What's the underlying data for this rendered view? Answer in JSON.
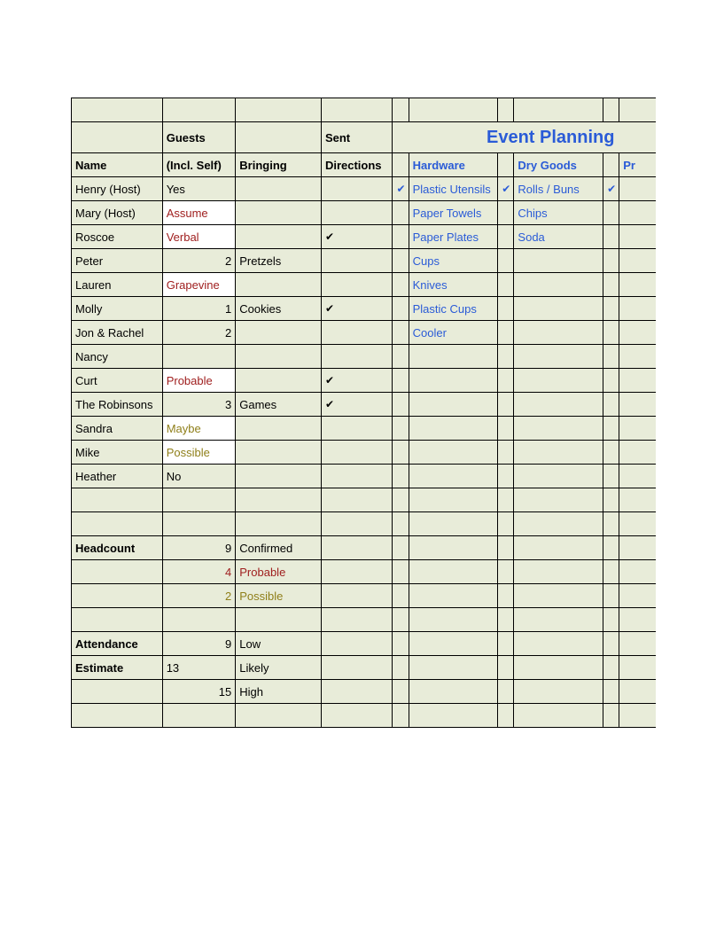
{
  "title": "Event Planning",
  "headers": {
    "guests": "Guests",
    "sent": "Sent",
    "name": "Name",
    "incl": "(Incl. Self)",
    "bringing": "Bringing",
    "directions": "Directions",
    "hardware": "Hardware",
    "drygoods": "Dry Goods",
    "pr": "Pr"
  },
  "rows": [
    {
      "name": "Henry (Host)",
      "guests": "Yes",
      "gcls": "",
      "bring": "",
      "sent": "",
      "hw_chk": "✔",
      "hw": "Plastic Utensils",
      "dg_chk": "✔",
      "dg": "Rolls / Buns",
      "pr_chk": "✔"
    },
    {
      "name": "Mary (Host)",
      "guests": "Assume",
      "gcls": "red white-bg",
      "bring": "",
      "sent": "",
      "hw_chk": "",
      "hw": "Paper Towels",
      "dg_chk": "",
      "dg": "Chips",
      "pr_chk": ""
    },
    {
      "name": "Roscoe",
      "guests": "Verbal",
      "gcls": "red white-bg",
      "bring": "",
      "sent": "✔",
      "hw_chk": "",
      "hw": "Paper Plates",
      "dg_chk": "",
      "dg": "Soda",
      "pr_chk": ""
    },
    {
      "name": "Peter",
      "guests": "2",
      "gcls": "right",
      "bring": "Pretzels",
      "sent": "",
      "hw_chk": "",
      "hw": "Cups",
      "dg_chk": "",
      "dg": "",
      "pr_chk": ""
    },
    {
      "name": "Lauren",
      "guests": "Grapevine",
      "gcls": "red white-bg",
      "bring": "",
      "sent": "",
      "hw_chk": "",
      "hw": "Knives",
      "dg_chk": "",
      "dg": "",
      "pr_chk": ""
    },
    {
      "name": "Molly",
      "guests": "1",
      "gcls": "right",
      "bring": "Cookies",
      "sent": "✔",
      "hw_chk": "",
      "hw": "Plastic Cups",
      "dg_chk": "",
      "dg": "",
      "pr_chk": ""
    },
    {
      "name": "Jon & Rachel",
      "guests": "2",
      "gcls": "right",
      "bring": "",
      "sent": "",
      "hw_chk": "",
      "hw": "Cooler",
      "dg_chk": "",
      "dg": "",
      "pr_chk": ""
    },
    {
      "name": "Nancy",
      "guests": "",
      "gcls": "",
      "bring": "",
      "sent": "",
      "hw_chk": "",
      "hw": "",
      "dg_chk": "",
      "dg": "",
      "pr_chk": ""
    },
    {
      "name": "Curt",
      "guests": "Probable",
      "gcls": "red white-bg",
      "bring": "",
      "sent": "✔",
      "hw_chk": "",
      "hw": "",
      "dg_chk": "",
      "dg": "",
      "pr_chk": ""
    },
    {
      "name": "The Robinsons",
      "guests": "3",
      "gcls": "right",
      "bring": "Games",
      "sent": "✔",
      "hw_chk": "",
      "hw": "",
      "dg_chk": "",
      "dg": "",
      "pr_chk": ""
    },
    {
      "name": "Sandra",
      "guests": "Maybe",
      "gcls": "olive white-bg",
      "bring": "",
      "sent": "",
      "hw_chk": "",
      "hw": "",
      "dg_chk": "",
      "dg": "",
      "pr_chk": ""
    },
    {
      "name": "Mike",
      "guests": "Possible",
      "gcls": "olive white-bg",
      "bring": "",
      "sent": "",
      "hw_chk": "",
      "hw": "",
      "dg_chk": "",
      "dg": "",
      "pr_chk": ""
    },
    {
      "name": "Heather",
      "guests": "No",
      "gcls": "",
      "bring": "",
      "sent": "",
      "hw_chk": "",
      "hw": "",
      "dg_chk": "",
      "dg": "",
      "pr_chk": ""
    }
  ],
  "summary": [
    {
      "a": "",
      "b": "",
      "c": "",
      "a_cls": "",
      "b_cls": "",
      "c_cls": ""
    },
    {
      "a": "",
      "b": "",
      "c": "",
      "a_cls": "",
      "b_cls": "",
      "c_cls": ""
    },
    {
      "a": "Headcount",
      "b": "9",
      "c": "Confirmed",
      "a_cls": "bold",
      "b_cls": "right",
      "c_cls": ""
    },
    {
      "a": "",
      "b": "4",
      "c": "Probable",
      "a_cls": "",
      "b_cls": "right red",
      "c_cls": "red"
    },
    {
      "a": "",
      "b": "2",
      "c": "Possible",
      "a_cls": "",
      "b_cls": "right olive",
      "c_cls": "olive"
    },
    {
      "a": "",
      "b": "",
      "c": "",
      "a_cls": "",
      "b_cls": "",
      "c_cls": ""
    },
    {
      "a": "Attendance",
      "b": "9",
      "c": "Low",
      "a_cls": "bold",
      "b_cls": "right",
      "c_cls": ""
    },
    {
      "a": "Estimate",
      "b": "13",
      "c": "Likely",
      "a_cls": "bold",
      "b_cls": "",
      "c_cls": ""
    },
    {
      "a": "",
      "b": "15",
      "c": "High",
      "a_cls": "",
      "b_cls": "right",
      "c_cls": ""
    },
    {
      "a": "",
      "b": "",
      "c": "",
      "a_cls": "",
      "b_cls": "",
      "c_cls": ""
    }
  ]
}
